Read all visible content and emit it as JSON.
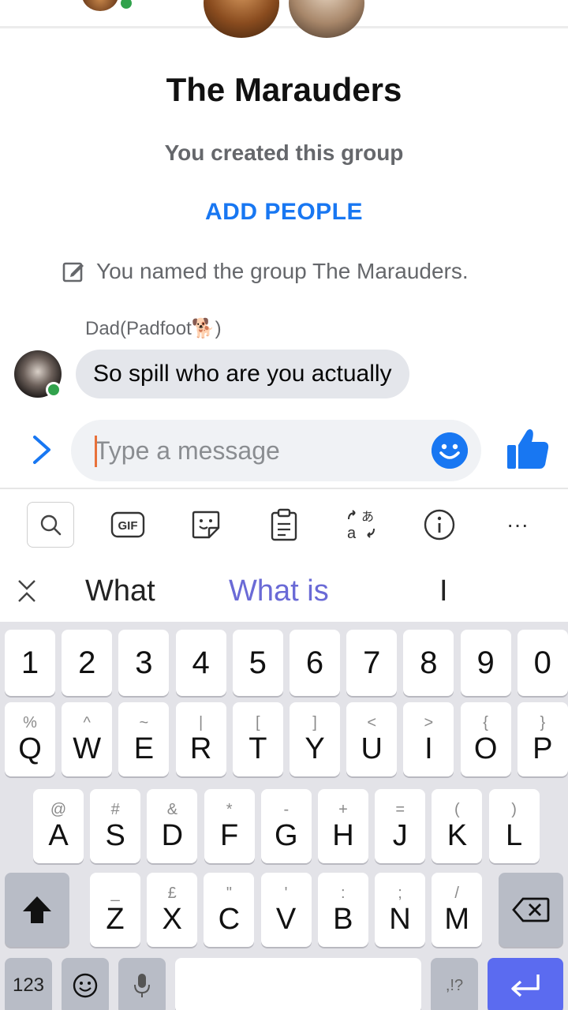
{
  "conversation": {
    "group_title": "The Marauders",
    "subtitle": "You created this group",
    "add_people_label": "ADD PEOPLE",
    "named_event": "You named the group The Marauders."
  },
  "messages": [
    {
      "sender": "Dad(Padfoot🐕)",
      "text": "So spill who are you actually"
    }
  ],
  "composer": {
    "placeholder": "Type a message"
  },
  "keyboard": {
    "toolbar": [
      "search-icon",
      "gif-icon",
      "sticker-icon",
      "clipboard-icon",
      "translate-icon",
      "info-icon",
      "more-icon"
    ],
    "gif_label": "GIF",
    "more_label": "···",
    "suggestions": [
      "What",
      "What is",
      "I"
    ],
    "number_row": [
      "1",
      "2",
      "3",
      "4",
      "5",
      "6",
      "7",
      "8",
      "9",
      "0"
    ],
    "row1": [
      {
        "k": "Q",
        "a": "%"
      },
      {
        "k": "W",
        "a": "^"
      },
      {
        "k": "E",
        "a": "~"
      },
      {
        "k": "R",
        "a": "|"
      },
      {
        "k": "T",
        "a": "["
      },
      {
        "k": "Y",
        "a": "]"
      },
      {
        "k": "U",
        "a": "<"
      },
      {
        "k": "I",
        "a": ">"
      },
      {
        "k": "O",
        "a": "{"
      },
      {
        "k": "P",
        "a": "}"
      }
    ],
    "row2": [
      {
        "k": "A",
        "a": "@"
      },
      {
        "k": "S",
        "a": "#"
      },
      {
        "k": "D",
        "a": "&"
      },
      {
        "k": "F",
        "a": "*"
      },
      {
        "k": "G",
        "a": "-"
      },
      {
        "k": "H",
        "a": "+"
      },
      {
        "k": "J",
        "a": "="
      },
      {
        "k": "K",
        "a": "("
      },
      {
        "k": "L",
        "a": ")"
      }
    ],
    "row3": [
      {
        "k": "Z",
        "a": "_"
      },
      {
        "k": "X",
        "a": "£"
      },
      {
        "k": "C",
        "a": "\""
      },
      {
        "k": "V",
        "a": "'"
      },
      {
        "k": "B",
        "a": ":"
      },
      {
        "k": "N",
        "a": ";"
      },
      {
        "k": "M",
        "a": "/"
      }
    ],
    "symbols_label": "123",
    "punct_label": ",!?"
  },
  "colors": {
    "accent": "#1877f2",
    "online": "#31a24c",
    "suggestion_highlight": "#6a6ad6",
    "enter_key": "#5b6bf0"
  }
}
